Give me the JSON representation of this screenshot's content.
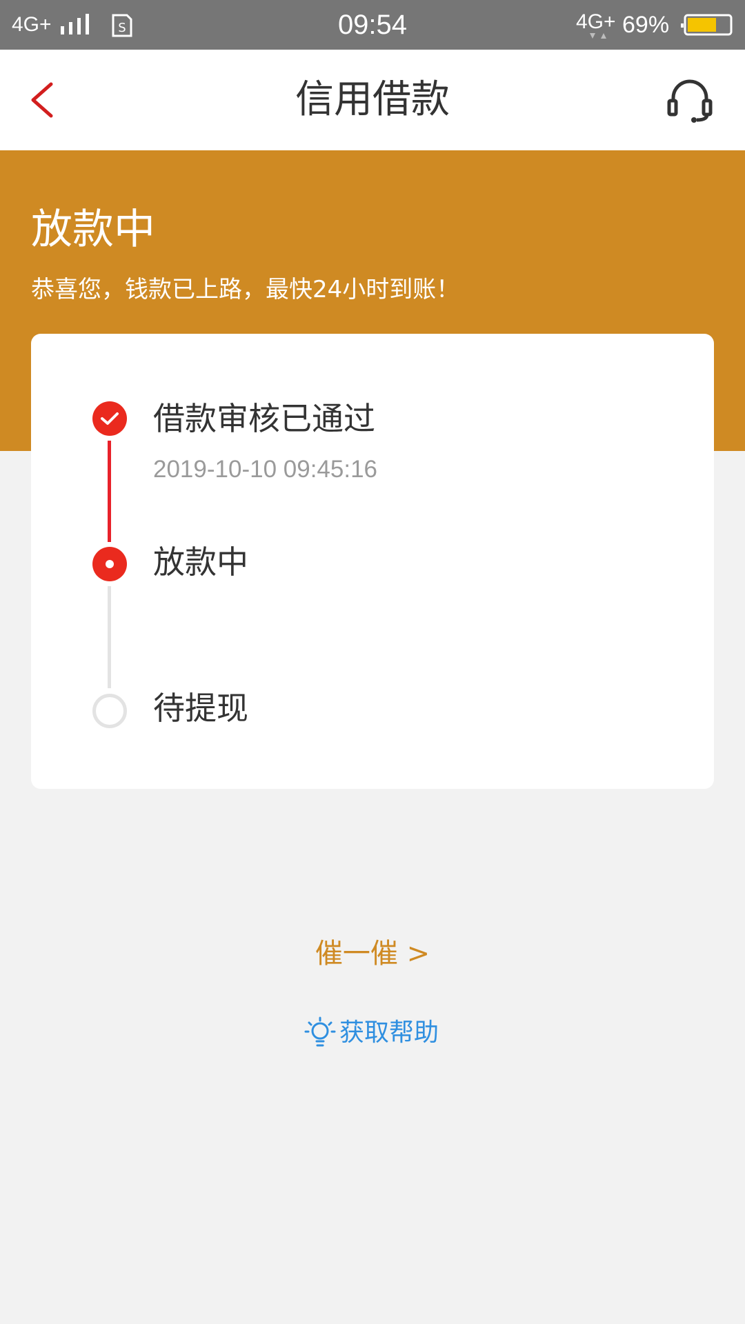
{
  "status_bar": {
    "network_left": "4G+",
    "time": "09:54",
    "network_right": "4G+",
    "battery_percent": "69%",
    "battery_level": 0.69,
    "battery_color": "#f5c400"
  },
  "nav": {
    "title": "信用借款",
    "back_icon": "chevron-left-icon",
    "service_icon": "headset-icon"
  },
  "header": {
    "status": "放款中",
    "message": "恭喜您，钱款已上路，最快24小时到账！",
    "background_color": "#cf8a23"
  },
  "progress": {
    "steps": [
      {
        "title": "借款审核已通过",
        "time": "2019-10-10 09:45:16",
        "state": "done"
      },
      {
        "title": "放款中",
        "state": "active"
      },
      {
        "title": "待提现",
        "state": "pending"
      }
    ],
    "accent_color": "#ea2a1e"
  },
  "actions": {
    "urge_label": "催一催 >",
    "help_label": "获取帮助",
    "help_icon": "lightbulb-icon"
  }
}
